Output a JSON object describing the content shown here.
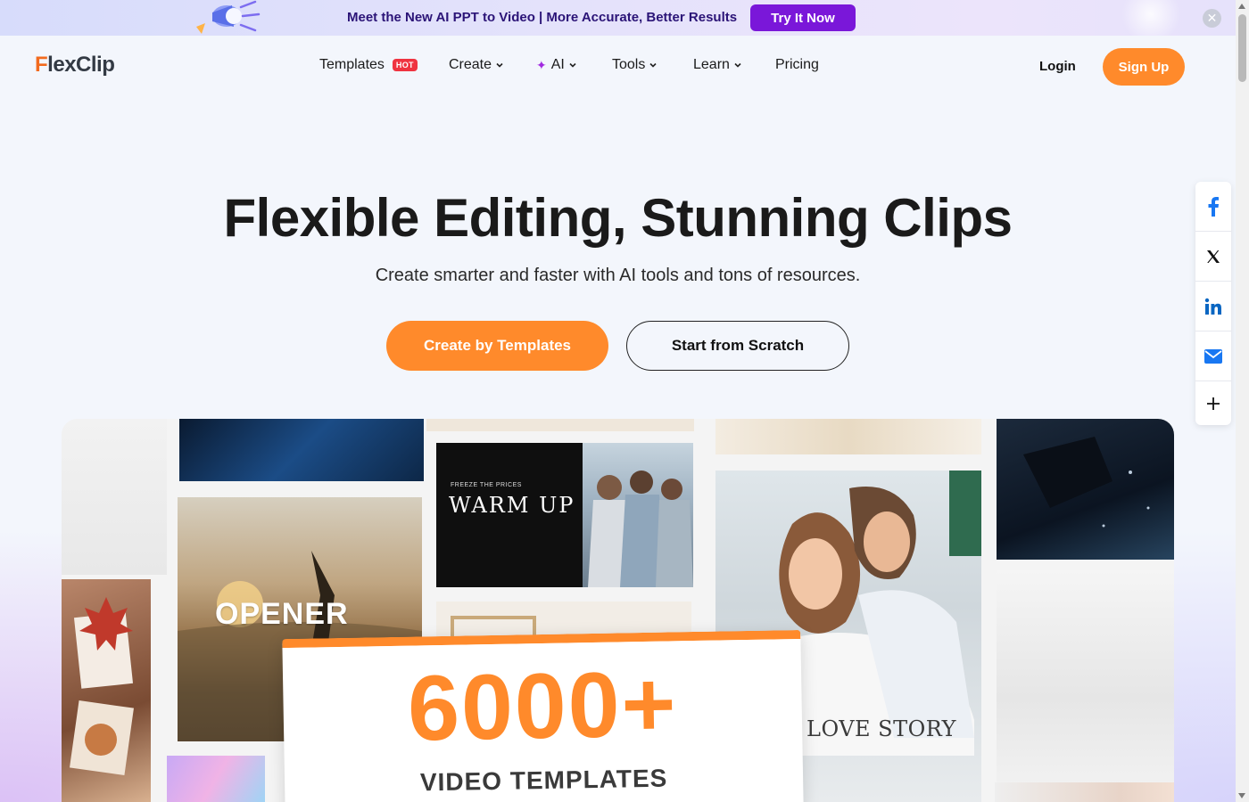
{
  "banner": {
    "message": "Meet the New AI PPT to Video | More Accurate, Better Results",
    "cta_label": "Try It Now",
    "close_icon": "close-icon"
  },
  "header": {
    "logo_initial": "F",
    "logo_rest": "lexClip",
    "nav": {
      "templates": "Templates",
      "hot_badge": "HOT",
      "create": "Create",
      "ai": "AI",
      "tools": "Tools",
      "learn": "Learn",
      "pricing": "Pricing"
    },
    "login_label": "Login",
    "signup_label": "Sign Up"
  },
  "hero": {
    "title": "Flexible Editing, Stunning Clips",
    "subtitle": "Create smarter and faster with AI tools and tons of resources.",
    "primary_cta": "Create by Templates",
    "secondary_cta": "Start from Scratch"
  },
  "share": {
    "icons": [
      "facebook-icon",
      "x-icon",
      "linkedin-icon",
      "email-icon",
      "plus-icon"
    ]
  },
  "showcase": {
    "opener_label": "OPENER",
    "warm_small": "FREEZE THE PRICES",
    "warm_title": "WARM UP",
    "love_label": "LOVE STORY",
    "count": "6000+",
    "count_label": "VIDEO TEMPLATES"
  },
  "colors": {
    "accent_orange": "#ff8a2b",
    "banner_button": "#7a17d9",
    "hot_badge": "#ef3340",
    "ai_spark": "#a129e0"
  }
}
